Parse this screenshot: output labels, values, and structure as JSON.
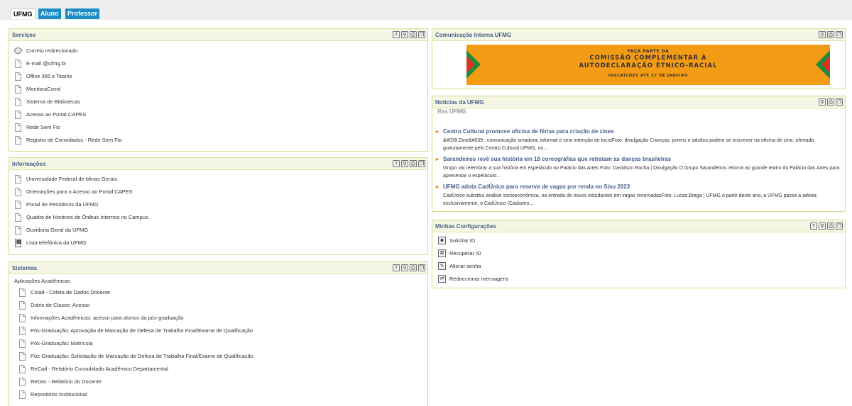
{
  "tabs": [
    {
      "label": "UFMG"
    },
    {
      "label": "Aluno"
    },
    {
      "label": "Professor"
    }
  ],
  "servicos": {
    "title": "Serviços",
    "items": [
      {
        "label": "Correio redirecionado"
      },
      {
        "label": "E-mail @ufmg.br"
      },
      {
        "label": "Office 365 e Teams"
      },
      {
        "label": "MonitoraCovid"
      },
      {
        "label": "Sistema de Bibliotecas"
      },
      {
        "label": "Acesso ao Portal CAPES"
      },
      {
        "label": "Rede Sem Fio"
      },
      {
        "label": "Registro de Convidados - Rede Sem Fio"
      }
    ]
  },
  "informacoes": {
    "title": "Informações",
    "items": [
      {
        "label": "Universidade Federal de Minas Gerais"
      },
      {
        "label": "Orientações para o Acesso ao Portal CAPES"
      },
      {
        "label": "Portal de Periódicos da UFMG"
      },
      {
        "label": "Quadro de Horários de Ônibus Internos no Campus"
      },
      {
        "label": "Ouvidoria Geral da UFMG"
      },
      {
        "label": "Lista telefônica da UFMG"
      }
    ]
  },
  "sistemas": {
    "title": "Sistemas",
    "subheading": "Aplicações Acadêmicas",
    "items": [
      {
        "label": "Colad - Coleta de Dados Docente"
      },
      {
        "label": "Diário de Classe: Acesso"
      },
      {
        "label": "Informações Acadêmicas: acesso para alunos da pós-graduação"
      },
      {
        "label": "Pós-Graduação: Aprovação de Marcação de Defesa de Trabalho Final/Exame de Qualificação"
      },
      {
        "label": "Pós-Graduação: Matrícula"
      },
      {
        "label": "Pós-Graduação: Solicitação de Marcação de Defesa de Trabalho Final/Exame de Qualificação"
      },
      {
        "label": "ReCad - Relatório Consolidado Acadêmico Departamental"
      },
      {
        "label": "ReDoc - Relatório do Docente"
      },
      {
        "label": "Repositório Institucional"
      }
    ]
  },
  "comunicacao": {
    "title": "Comunicação Interna UFMG",
    "banner": {
      "line1": "FAÇA PARTE DA",
      "line2": "COMISSÃO COMPLEMENTAR À",
      "line3": "AUTODECLARAÇÃO ÉTNICO-RACIAL",
      "line4": "INSCRIÇÕES ATÉ 27 DE JANEIRO"
    }
  },
  "noticias": {
    "title": "Notícias da UFMG",
    "source": "Rss UFMG",
    "items": [
      {
        "title": "Centro Cultural promove oficina de férias para criação de zines",
        "body": "&#039;Zine&#039;: comunicação amadora, informal e sem intenção de lucroFoto: divulgação Crianças, jovens e adultos podem se inscrever na oficina de zine, ofertada gratuitamente pelo Centro Cultural UFMG, no..."
      },
      {
        "title": "Sarandeiros revê sua história em 18 coreografias que retratam as danças brasileiras",
        "body": "Grupo vai relembrar a sua história em espetáculo no Palácio das Artes Foto: Davidson Rocha | Divulgação O Grupo Sarandeiros retorna ao grande teatro do Palácio das Artes para apresentar o espetáculo..."
      },
      {
        "title": "UFMG adota CadÚnico para reserva de vagas por renda no Sisu 2023",
        "body": "CadÚnico substitui análise socioeconômica, na entrada de novos estudantes em vagas reservadasFoto: Lucas Braga | UFMG A partir deste ano, a UFMG passa a adotar, exclusivamente, o CadÚnico (Cadastro..."
      }
    ]
  },
  "configuracoes": {
    "title": "Minhas Configurações",
    "items": [
      {
        "label": "Solicitar ID"
      },
      {
        "label": "Recuperar ID"
      },
      {
        "label": "Alterar senha"
      },
      {
        "label": "Redirecionar mensagens"
      }
    ]
  },
  "colors": {
    "tab_blue": "#1b8cc6",
    "box_border": "#cfe08c",
    "title_blue": "#47608a",
    "banner_orange": "#f39b15",
    "banner_green": "#1e8a3c",
    "banner_red": "#d8342a"
  }
}
